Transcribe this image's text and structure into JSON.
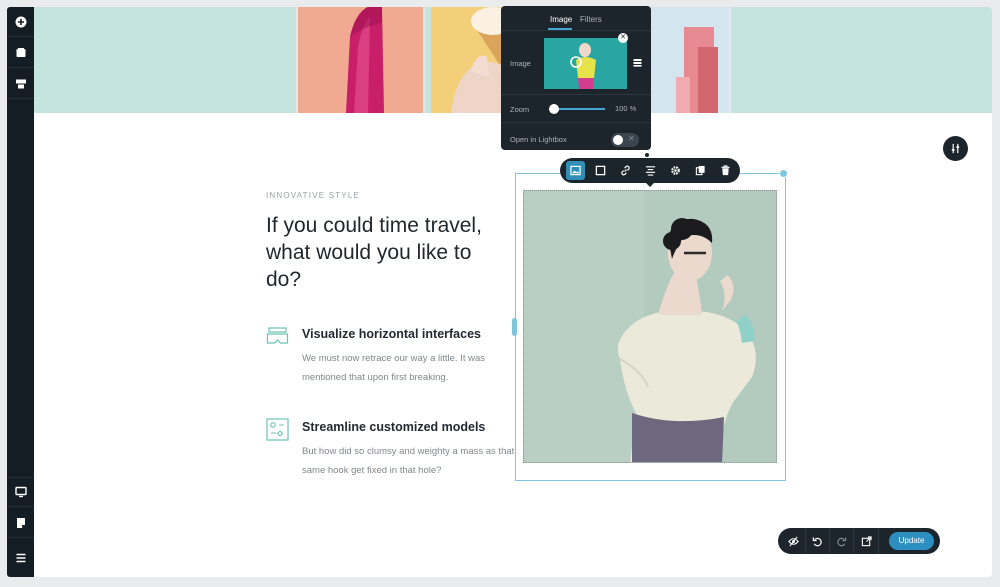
{
  "sidebar": {
    "top_icons": [
      "plus-circle-icon",
      "layers-icon",
      "layout-icon"
    ],
    "bottom_icons": [
      "desktop-icon",
      "page-icon",
      "menu-icon"
    ]
  },
  "section": {
    "eyebrow": "INNOVATIVE STYLE",
    "headline": "If you could time travel, what would you like to do?",
    "features": [
      {
        "icon": "vr-headset-icon",
        "title": "Visualize horizontal interfaces",
        "text": "We must now retrace our way a little. It was mentioned that upon first breaking."
      },
      {
        "icon": "flowchart-icon",
        "title": "Streamline customized models",
        "text": "But how did so clumsy and weighty a mass as that same hook get fixed in that hole?"
      }
    ]
  },
  "image_popover": {
    "tabs": [
      "Image",
      "Filters"
    ],
    "active_tab": "Image",
    "image_label": "Image",
    "zoom_label": "Zoom",
    "zoom_value": "100 %",
    "lightbox_label": "Open in Lightbox",
    "lightbox_on": false
  },
  "image_toolbar": {
    "buttons": [
      "image-icon",
      "frame-icon",
      "link-icon",
      "align-icon",
      "gear-icon",
      "duplicate-icon",
      "trash-icon"
    ],
    "active": "image-icon"
  },
  "action_bar": {
    "buttons": [
      "hide-icon",
      "undo-icon",
      "redo-icon",
      "external-link-icon"
    ],
    "update_label": "Update"
  },
  "colors": {
    "accent": "#2d8fbf",
    "selection": "#7ec6de",
    "dark_ui": "#1d252c",
    "hero_bg": "#c6e4df"
  }
}
